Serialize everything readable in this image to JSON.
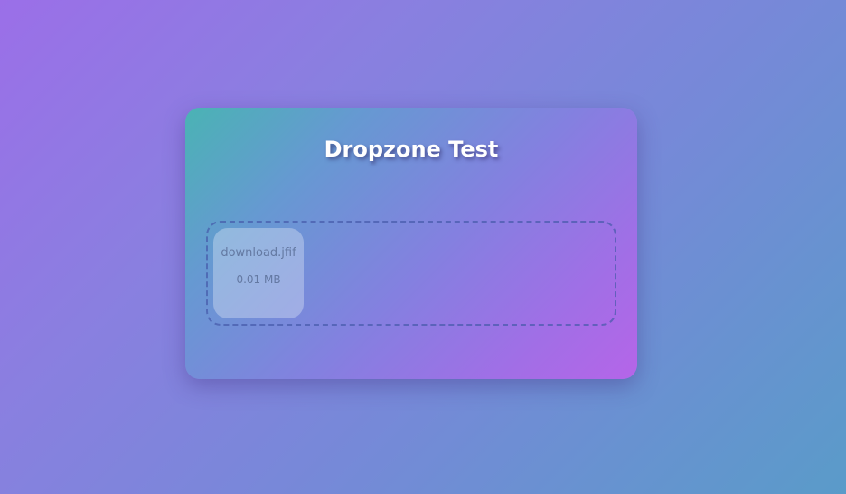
{
  "page": {
    "title": "Dropzone Test"
  },
  "dropzone": {
    "files": [
      {
        "name": "download.jfif",
        "size": "0.01 MB"
      }
    ]
  },
  "colors": {
    "background_start": "#9b6fe8",
    "background_end": "#5a9bc9",
    "card_start": "#4ab3b4",
    "card_end": "#b565e8",
    "title_text": "#ffffff",
    "dropzone_border": "#465aaa"
  }
}
